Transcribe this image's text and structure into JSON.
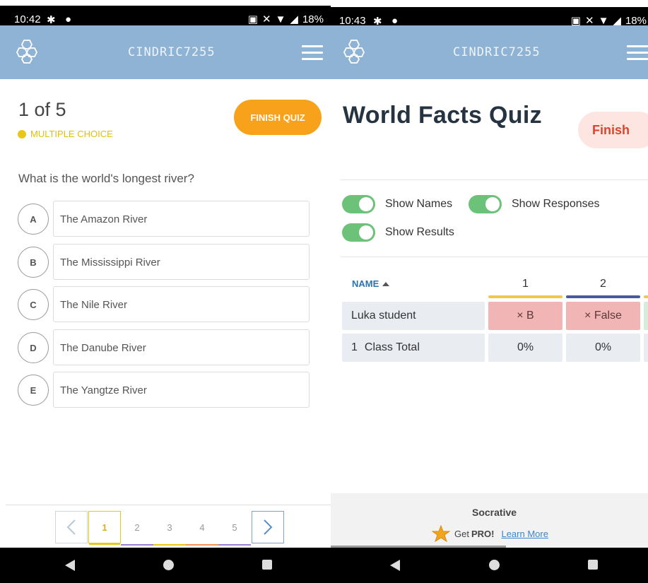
{
  "left": {
    "status": {
      "time": "10:42",
      "battery": "18%"
    },
    "appbar": {
      "room": "CINDRIC7255"
    },
    "quiz": {
      "counter": "1 of 5",
      "finish_label": "FINISH QUIZ",
      "qtype": "MULTIPLE CHOICE",
      "question": "What is the world's longest river?",
      "choices": [
        {
          "letter": "A",
          "text": "The Amazon River"
        },
        {
          "letter": "B",
          "text": "The Mississippi River"
        },
        {
          "letter": "C",
          "text": "The Nile River"
        },
        {
          "letter": "D",
          "text": "The Danube River"
        },
        {
          "letter": "E",
          "text": "The Yangtze River"
        }
      ]
    },
    "pager": {
      "pages": [
        "1",
        "2",
        "3",
        "4",
        "5"
      ],
      "active": "1",
      "colors": [
        "#e7c718",
        "#9b7fd0",
        "#e7c718",
        "#f2945a",
        "#9b7fd0"
      ]
    }
  },
  "right": {
    "status": {
      "time": "10:43",
      "battery": "18%"
    },
    "appbar": {
      "room": "CINDRIC7255"
    },
    "title": "World Facts Quiz",
    "finish_label": "Finish",
    "toggles": [
      {
        "label": "Show Names",
        "on": true
      },
      {
        "label": "Show Responses",
        "on": true
      },
      {
        "label": "Show Results",
        "on": true
      }
    ],
    "table": {
      "name_header": "NAME",
      "questions": [
        "1",
        "2"
      ],
      "question_colors": [
        "#f0c84a",
        "#4b5a9c",
        "#f0c84a"
      ],
      "rows": [
        {
          "name": "Luka student",
          "answers": [
            "× B",
            "× False"
          ]
        }
      ],
      "total": {
        "count": "1",
        "label": "Class Total",
        "values": [
          "0%",
          "0%"
        ]
      }
    },
    "footer": {
      "brand": "Socrative",
      "get": "Get",
      "pro": "PRO!",
      "learn_more": "Learn More"
    }
  },
  "colors": {
    "appbar": "#8fb3d4",
    "accent_orange": "#f7a21a",
    "toggle_on": "#6dc27a",
    "wrong": "#f2b5b5",
    "finish_text": "#d9462e"
  }
}
